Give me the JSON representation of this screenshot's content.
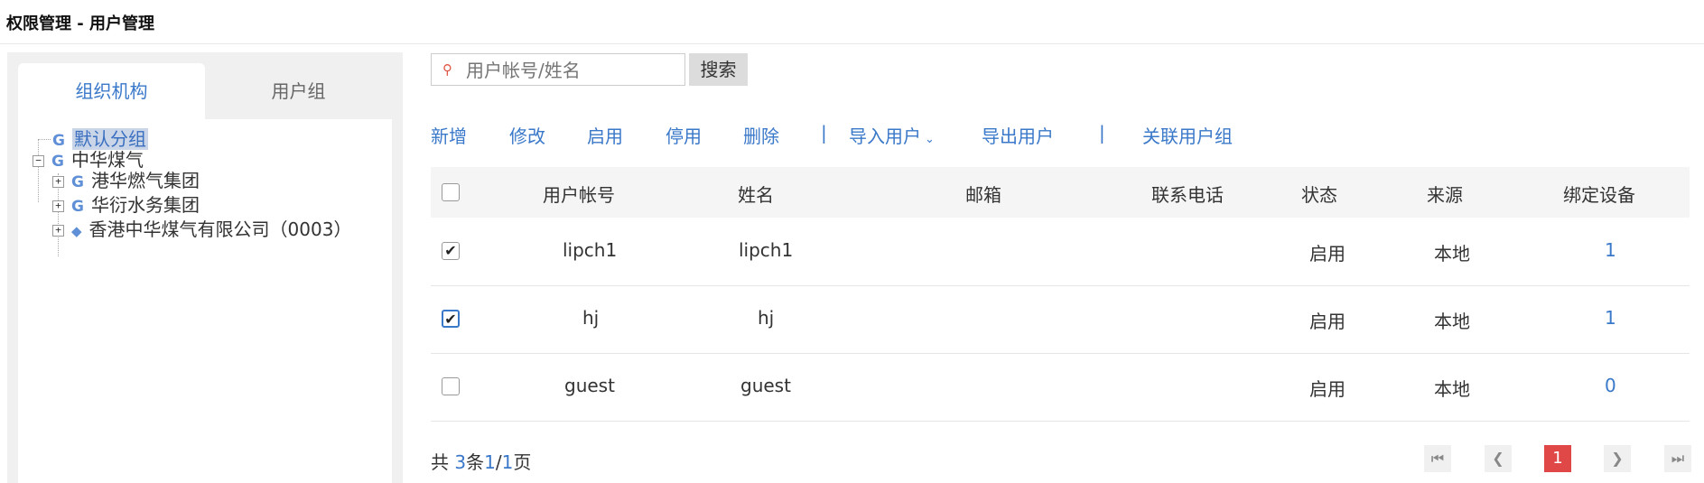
{
  "header": {
    "title": "权限管理 -  用户管理"
  },
  "left": {
    "tabs": [
      "组织机构",
      "用户组"
    ],
    "tree": [
      {
        "label": "默认分组",
        "icon": "g-icon"
      },
      {
        "label": "中华煤气",
        "icon": "g-icon",
        "expand": "⊟"
      },
      {
        "label": "港华燃气集团",
        "icon": "g-icon",
        "expand": "⊞"
      },
      {
        "label": "华衍水务集团",
        "icon": "g-icon",
        "expand": "⊞"
      },
      {
        "label": "香港中华煤气有限公司（0003）",
        "icon": "diamond-icon",
        "expand": "⊞"
      }
    ]
  },
  "search": {
    "placeholder": "用户帐号/姓名",
    "button": "搜索"
  },
  "toolbar": {
    "add": "新增",
    "edit": "修改",
    "enable": "启用",
    "disable": "停用",
    "delete": "删除",
    "sep": "|",
    "import": "导入用户",
    "export": "导出用户",
    "link_group": "关联用户组"
  },
  "table": {
    "columns": [
      "用户帐号",
      "姓名",
      "邮箱",
      "联系电话",
      "状态",
      "来源",
      "绑定设备"
    ],
    "rows": [
      {
        "checked": true,
        "account": "lipch1",
        "name": "lipch1",
        "email": "",
        "phone": "",
        "status": "启用",
        "source": "本地",
        "devices": "1"
      },
      {
        "checked": true,
        "account": "hj",
        "name": "hj",
        "email": "",
        "phone": "",
        "status": "启用",
        "source": "本地",
        "devices": "1"
      },
      {
        "checked": false,
        "account": "guest",
        "name": "guest",
        "email": "",
        "phone": "",
        "status": "启用",
        "source": "本地",
        "devices": "0"
      }
    ]
  },
  "pager": {
    "prefix": "共",
    "total": "3",
    "mid": "条",
    "page": "1",
    "slash": "/",
    "pages": "1",
    "suffix": "页",
    "current": "1"
  },
  "colors": {
    "accent": "#3a78c9",
    "current_page": "#e04848"
  }
}
